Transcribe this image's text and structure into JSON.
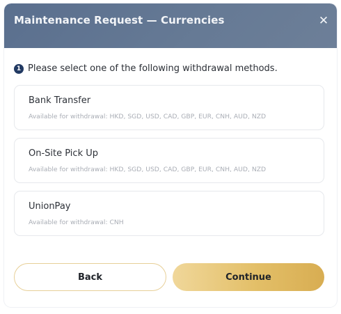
{
  "dialog": {
    "title": "Maintenance Request — Currencies",
    "close_icon": "close-icon",
    "close_glyph": "✕"
  },
  "instruction": {
    "step_number": "1",
    "text": "Please select one of the following withdrawal methods."
  },
  "options": [
    {
      "name": "Bank Transfer",
      "availability": "Available for withdrawal: HKD, SGD, USD, CAD, GBP, EUR, CNH, AUD, NZD"
    },
    {
      "name": "On-Site Pick Up",
      "availability": "Available for withdrawal: HKD, SGD, USD, CAD, GBP, EUR, CNH, AUD, NZD"
    },
    {
      "name": "UnionPay",
      "availability": "Available for withdrawal: CNH"
    }
  ],
  "buttons": {
    "back_label": "Back",
    "continue_label": "Continue"
  },
  "colors": {
    "header": "#5f7391",
    "step_badge": "#223a63",
    "accent_gold": "#e3bf68"
  }
}
